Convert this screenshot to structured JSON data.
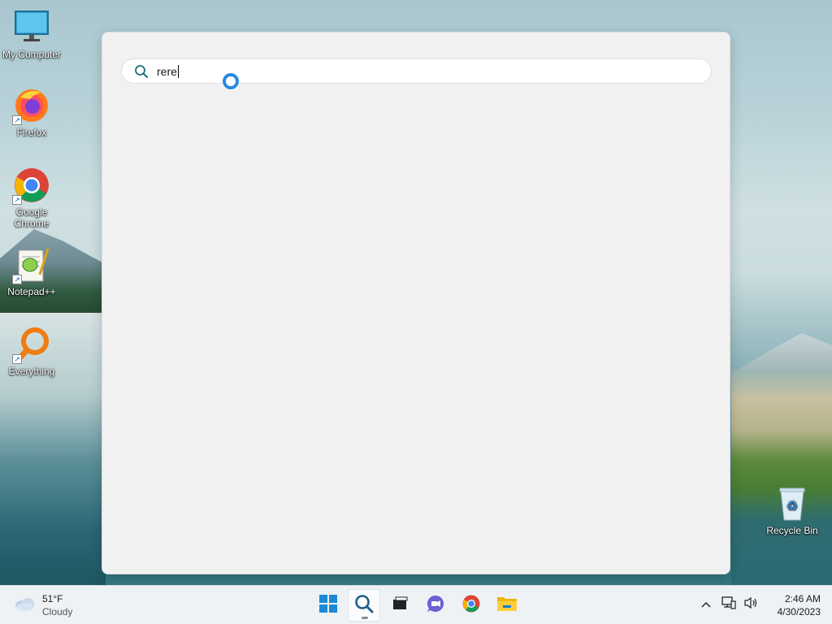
{
  "desktop": {
    "icons": [
      {
        "label": "My Computer"
      },
      {
        "label": "Firefox"
      },
      {
        "label": "Google Chrome"
      },
      {
        "label": "Notepad++"
      },
      {
        "label": "Everything"
      },
      {
        "label": "Recycle Bin"
      }
    ]
  },
  "search": {
    "query": "rere",
    "icon": "search-icon"
  },
  "taskbar": {
    "weather": {
      "temp": "51°F",
      "condition": "Cloudy"
    },
    "apps": [
      {
        "name": "Start",
        "icon": "windows-logo-icon"
      },
      {
        "name": "Search",
        "icon": "search-icon",
        "active": true
      },
      {
        "name": "Task View",
        "icon": "task-view-icon"
      },
      {
        "name": "Chat",
        "icon": "chat-icon"
      },
      {
        "name": "Google Chrome",
        "icon": "chrome-icon"
      },
      {
        "name": "File Explorer",
        "icon": "folder-icon"
      }
    ],
    "tray": {
      "icons": [
        "chevron-up-icon",
        "network-icon",
        "volume-icon"
      ]
    },
    "clock": {
      "time": "2:46 AM",
      "date": "4/30/2023"
    }
  },
  "colors": {
    "accent": "#2a8ae0",
    "taskbar_bg": "#eef2f5",
    "panel_bg": "#f1f1f1"
  }
}
